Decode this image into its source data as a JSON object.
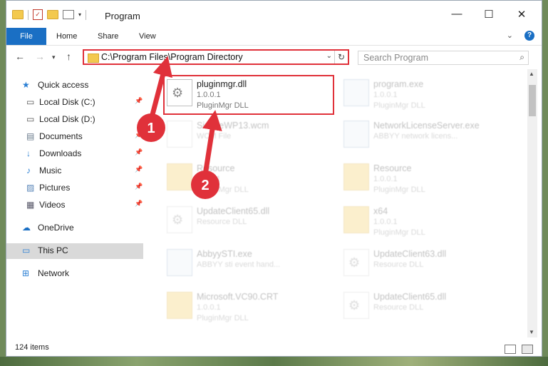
{
  "window": {
    "title": "Program"
  },
  "ribbon": {
    "file": "File",
    "home": "Home",
    "share": "Share",
    "view": "View",
    "help_icon": "?"
  },
  "address": {
    "path": "C:\\Program Files\\Program Directory"
  },
  "search": {
    "placeholder": "Search Program"
  },
  "sidebar": [
    {
      "label": "Quick access",
      "icon": "star-icon",
      "top": true
    },
    {
      "label": "Local Disk (C:)",
      "icon": "drive-icon",
      "pinned": true
    },
    {
      "label": "Local Disk (D:)",
      "icon": "drive-icon",
      "pinned": false
    },
    {
      "label": "Documents",
      "icon": "document-icon",
      "pinned": true
    },
    {
      "label": "Downloads",
      "icon": "download-icon",
      "pinned": true
    },
    {
      "label": "Music",
      "icon": "music-icon",
      "pinned": true
    },
    {
      "label": "Pictures",
      "icon": "pictures-icon",
      "pinned": true
    },
    {
      "label": "Videos",
      "icon": "video-icon",
      "pinned": true
    },
    {
      "label": "OneDrive",
      "icon": "cloud-icon",
      "top": true
    },
    {
      "label": "This PC",
      "icon": "pc-icon",
      "top": true,
      "selected": true
    },
    {
      "label": "Network",
      "icon": "network-icon",
      "top": true
    }
  ],
  "files": [
    {
      "name": "pluginmgr.dll",
      "version": "1.0.0.1",
      "desc": "PluginMgr DLL",
      "kind": "dll",
      "highlighted": true
    },
    {
      "name": "program.exe",
      "version": "1.0.0.1",
      "desc": "PluginMgr DLL",
      "kind": "exe"
    },
    {
      "name": "SimpleWP13.wcm",
      "version": "WCM File",
      "desc": "",
      "kind": "file"
    },
    {
      "name": "NetworkLicenseServer.exe",
      "version": "ABBYY network licens...",
      "desc": "",
      "kind": "exe"
    },
    {
      "name": "Resource",
      "version": "1.0.0.1",
      "desc": "PluginMgr DLL",
      "kind": "folder"
    },
    {
      "name": "Resource",
      "version": "1.0.0.1",
      "desc": "PluginMgr DLL",
      "kind": "folder"
    },
    {
      "name": "UpdateClient65.dll",
      "version": "Resource DLL",
      "desc": "",
      "kind": "dll"
    },
    {
      "name": "x64",
      "version": "1.0.0.1",
      "desc": "PluginMgr DLL",
      "kind": "folder"
    },
    {
      "name": "AbbyySTI.exe",
      "version": "ABBYY sti event hand...",
      "desc": "",
      "kind": "exe"
    },
    {
      "name": "UpdateClient63.dll",
      "version": "Resource DLL",
      "desc": "",
      "kind": "dll"
    },
    {
      "name": "Microsoft.VC90.CRT",
      "version": "1.0.0.1",
      "desc": "PluginMgr DLL",
      "kind": "folder"
    },
    {
      "name": "UpdateClient65.dll",
      "version": "Resource DLL",
      "desc": "",
      "kind": "dll"
    }
  ],
  "status": {
    "count": "124 items"
  },
  "annotations": {
    "marker1": "1",
    "marker2": "2"
  },
  "colors": {
    "accent": "#1a6fc4",
    "highlight": "#e0313a"
  }
}
